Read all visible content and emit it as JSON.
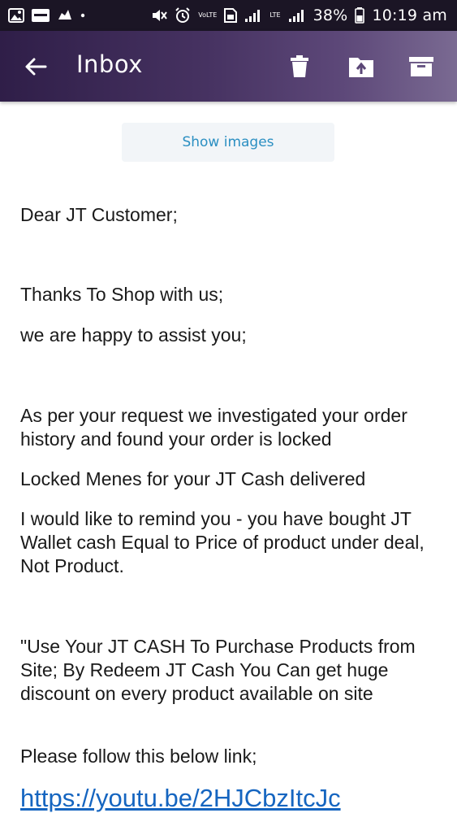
{
  "status_bar": {
    "carrier_label": "VoLTE",
    "network": "LTE",
    "battery": "38%",
    "time": "10:19 am"
  },
  "app_bar": {
    "title": "Inbox",
    "icons": [
      "back-arrow-icon",
      "trash-icon",
      "move-to-folder-icon",
      "archive-icon"
    ]
  },
  "email": {
    "show_images_label": "Show images",
    "greeting": "Dear JT Customer;",
    "line_thanks": "Thanks To Shop with us;",
    "line_happy": "we are happy to assist you;",
    "para_investigated": "As per your request we investigated your order history and found your order is locked",
    "para_locked": "Locked Menes for your JT Cash delivered",
    "para_remind": "I would like to remind you - you have bought JT Wallet cash Equal to Price of product under deal, Not Product.",
    "para_use": "\"Use Your JT CASH To Purchase Products from Site; By Redeem JT Cash You Can get huge discount on every product available on site",
    "para_follow": "Please follow this below link;",
    "link": "https://youtu.be/2HJCbzItcJc"
  },
  "colors": {
    "status_bar_bg": "#1b1525",
    "app_bar_start": "#2f1e48",
    "app_bar_end": "#7a6a92",
    "link": "#1565c0",
    "show_images_text": "#2b8fc2"
  }
}
